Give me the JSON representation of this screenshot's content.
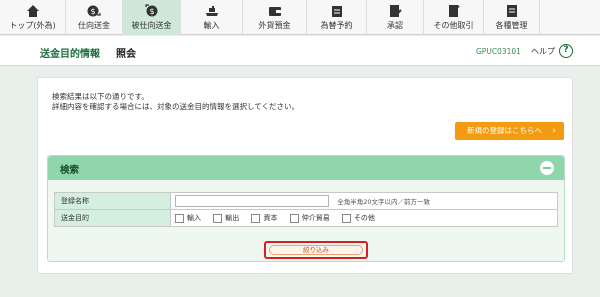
{
  "nav": {
    "items": [
      {
        "label": "トップ(外為)",
        "icon": "home-icon"
      },
      {
        "label": "仕向送金",
        "icon": "outgoing-remittance-icon"
      },
      {
        "label": "被仕向送金",
        "icon": "incoming-remittance-icon"
      },
      {
        "label": "輸入",
        "icon": "import-icon"
      },
      {
        "label": "外貨預金",
        "icon": "foreign-deposit-icon"
      },
      {
        "label": "為替予約",
        "icon": "exchange-contract-icon"
      },
      {
        "label": "承認",
        "icon": "approval-icon"
      },
      {
        "label": "その他取引",
        "icon": "other-transactions-icon"
      },
      {
        "label": "各種管理",
        "icon": "management-icon"
      }
    ],
    "active_index": 2
  },
  "header": {
    "title": "送金目的情報",
    "subtitle": "照会",
    "screen_id": "GPUC03101",
    "help_label": "ヘルプ",
    "help_icon": "?"
  },
  "main": {
    "info_line1": "検索結果は以下の通りです。",
    "info_line2": "詳細内容を確認する場合には、対象の送金目的情報を選択してください。",
    "new_registration_label": "新規の登録はこちらへ",
    "new_registration_chevron": "›"
  },
  "search": {
    "title": "検索",
    "rows": {
      "name_label": "登録名称",
      "name_value": "",
      "name_hint": "全角半角20文字以内／前方一致",
      "purpose_label": "送金目的",
      "purposes": [
        "輸入",
        "輸出",
        "資本",
        "仲介貿易",
        "その他"
      ]
    },
    "filter_button": "絞り込み"
  },
  "colors": {
    "brand_green": "#1d6e3f",
    "accent_orange": "#f39c12",
    "section_header": "#8fd6ad",
    "highlight_red": "#d62020"
  }
}
